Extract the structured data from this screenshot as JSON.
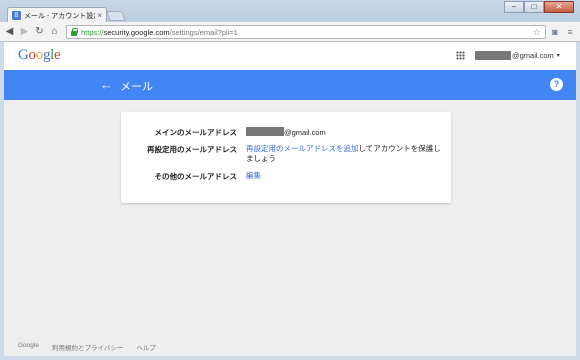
{
  "browser": {
    "tab_favicon": "8",
    "tab_title": "メール - アカウント設定",
    "tab_close": "×",
    "url_scheme": "https://",
    "url_host": "security.google.com",
    "url_path": "/settings/email?pli=1",
    "window_controls": {
      "minimize": "–",
      "maximize": "□",
      "close": "✕"
    }
  },
  "header": {
    "logo": [
      "G",
      "o",
      "o",
      "g",
      "l",
      "e"
    ],
    "account_suffix": "@gmail.com",
    "account_caret": "▾"
  },
  "bluebar": {
    "back_icon": "←",
    "title": "メール",
    "help_icon": "?"
  },
  "email_settings": {
    "primary": {
      "label": "メインのメールアドレス",
      "value_suffix": "@gmail.com"
    },
    "recovery": {
      "label": "再設定用のメールアドレス",
      "link": "再設定用のメールアドレスを追加",
      "text": "してアカウントを保護しましょう"
    },
    "other": {
      "label": "その他のメールアドレス",
      "link": "編集"
    }
  },
  "footer": {
    "links": [
      "Google",
      "利用規約とプライバシー",
      "ヘルプ"
    ]
  }
}
